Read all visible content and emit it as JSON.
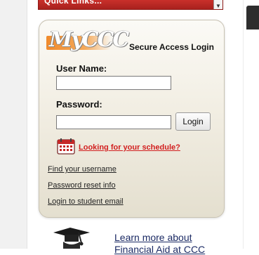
{
  "quick_links": {
    "label": "Quick Links..."
  },
  "login_panel": {
    "logo_text": "MyCCC",
    "title": "Secure Access Login",
    "username_label": "User Name:",
    "username_value": "",
    "password_label": "Password:",
    "password_value": "",
    "login_button": "Login",
    "schedule_link": "Looking for your schedule?",
    "links": [
      "Find your username",
      "Password reset info",
      "Login to student email"
    ]
  },
  "bottom": {
    "learn_more_line1": "Learn more about",
    "learn_more_line2": "Financial Aid at CCC"
  },
  "colors": {
    "quick_links_bg": "#b8282a",
    "logo_orange": "#f08a2c",
    "schedule_link": "#d21e1e",
    "learn_more": "#1b2a64"
  },
  "icons": [
    "calendar-icon",
    "graduation-cap-icon",
    "dropdown-arrow-icon"
  ]
}
